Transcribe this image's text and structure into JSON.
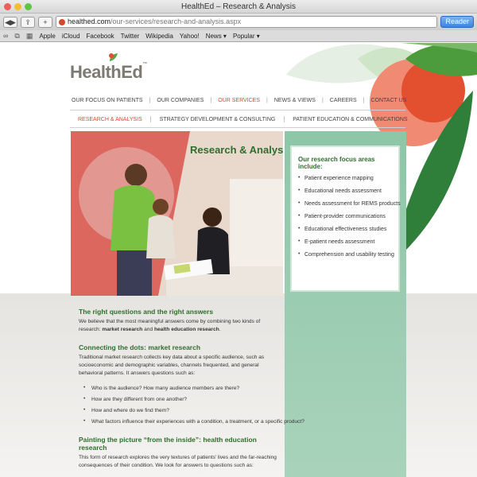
{
  "window": {
    "title": "HealthEd – Research & Analysis"
  },
  "toolbar": {
    "url_host": "healthed.com",
    "url_path": "/our-services/research-and-analysis.aspx",
    "reader_label": "Reader"
  },
  "bookmarks": [
    "Apple",
    "iCloud",
    "Facebook",
    "Twitter",
    "Wikipedia",
    "Yahoo!",
    "News ▾",
    "Popular ▾"
  ],
  "logo": {
    "text": "HealthEd",
    "tm": "™"
  },
  "nav": {
    "main": [
      "OUR FOCUS ON PATIENTS",
      "OUR COMPANIES",
      "OUR SERVICES",
      "NEWS & VIEWS",
      "CAREERS",
      "CONTACT US"
    ],
    "main_active": 2,
    "sub": [
      "RESEARCH & ANALYSIS",
      "STRATEGY DEVELOPMENT & CONSULTING",
      "PATIENT EDUCATION & COMMUNICATIONS"
    ],
    "sub_active": 0
  },
  "hero": {
    "title": "Research & Analysis"
  },
  "sidebar": {
    "heading": "Our research focus areas include:",
    "items": [
      "Patient experience mapping",
      "Educational needs assessment",
      "Needs assessment for REMS products",
      "Patient-provider communications",
      "Educational effectiveness studies",
      "E-patient needs assessment",
      "Comprehension and usability testing"
    ]
  },
  "content": {
    "s1_heading": "The right questions and the right answers",
    "s1_text_a": "We believe that the most meaningful answers come by combining two kinds of research: ",
    "s1_bold1": "market research",
    "s1_text_b": " and ",
    "s1_bold2": "health education research",
    "s1_text_c": ".",
    "s2_heading": "Connecting the dots: market research",
    "s2_text": "Traditional market research collects key data about a specific audience, such as socioeconomic and demographic variables, channels frequented, and general behavioral patterns. It answers questions such as:",
    "s2_questions": [
      "Who is the audience?  How many audience members are there?",
      "How are they different from one another?",
      "How and where do we find them?",
      "What factors influence their experiences with a condition, a treatment, or a specific product?"
    ],
    "s3_heading": "Painting the picture “from the inside”: health education research",
    "s3_text": "This form of research explores the very textures of patients’ lives and the far-reaching consequences of their condition. We look for answers to questions such as:"
  },
  "colors": {
    "accent": "#d94b2b",
    "brand_green": "#2f6e2d",
    "sidebar_green": "#8dc6a8"
  }
}
